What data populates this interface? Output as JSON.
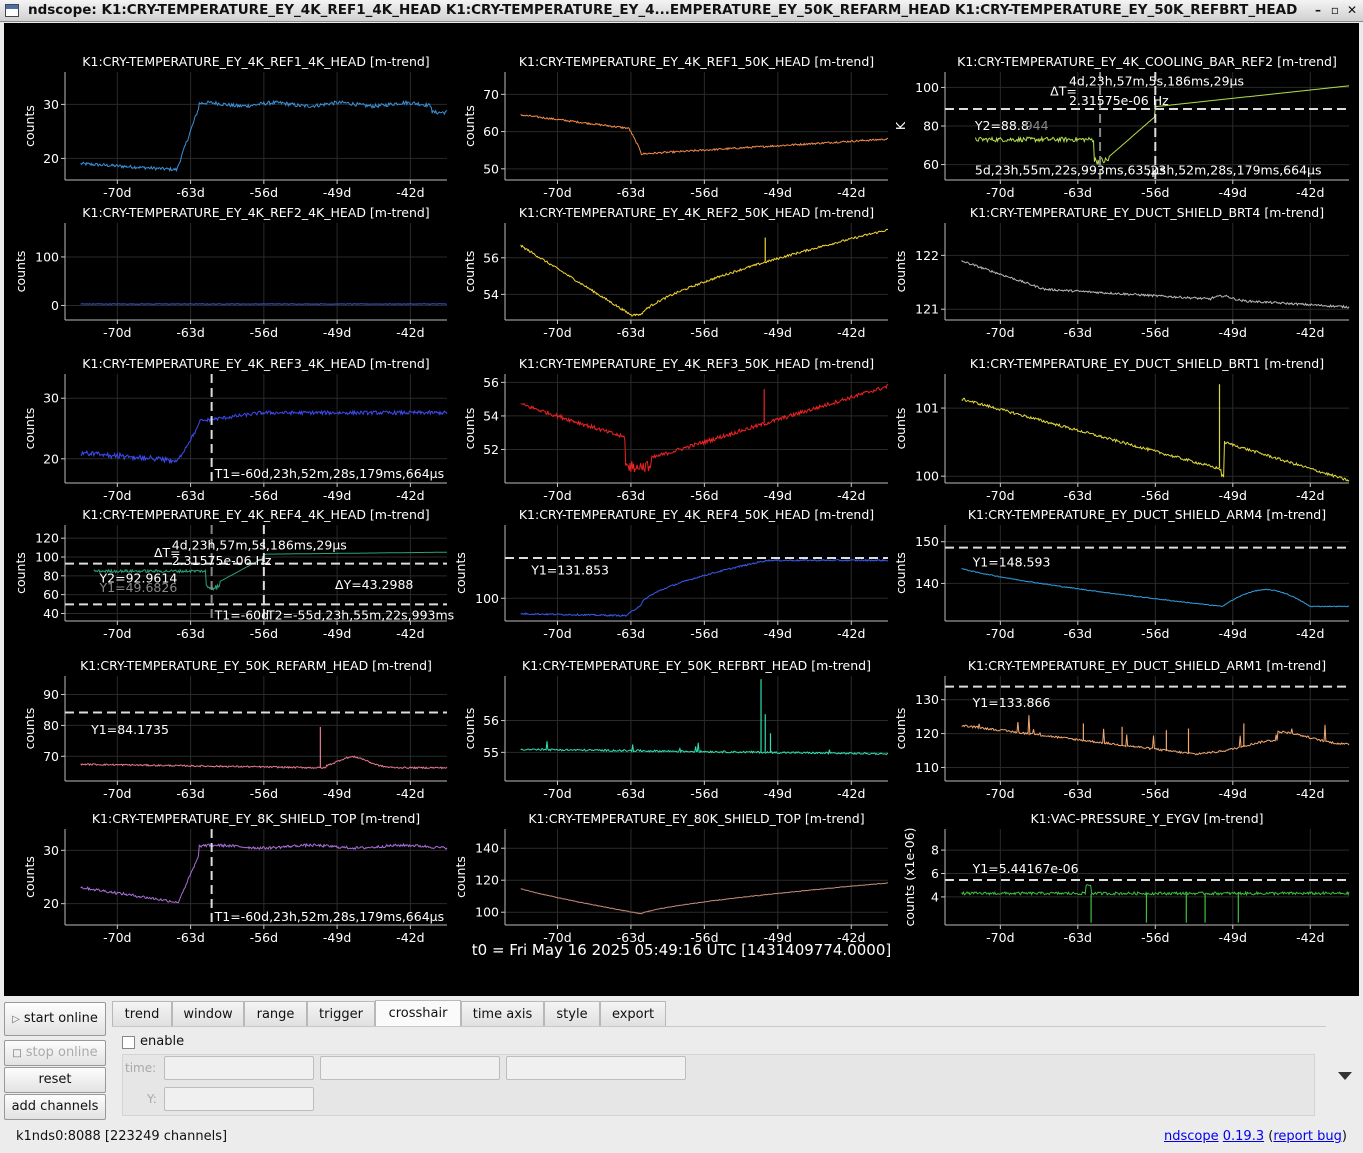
{
  "window": {
    "title": "ndscope: K1:CRY-TEMPERATURE_EY_4K_REF1_4K_HEAD K1:CRY-TEMPERATURE_EY_4...EMPERATURE_EY_50K_REFARM_HEAD K1:CRY-TEMPERATURE_EY_50K_REFBRT_HEAD",
    "minimize": "–",
    "maximize": "▫",
    "close": "✕"
  },
  "t0_label": "t0 = Fri May 16 2025 05:49:16 UTC [1431409774.0000]",
  "xticks": [
    "-70d",
    "-63d",
    "-56d",
    "-49d",
    "-42d"
  ],
  "plots": [
    {
      "title": "K1:CRY-TEMPERATURE_EY_4K_REF1_4K_HEAD [m-trend]",
      "ylabel": "counts",
      "ylim": [
        16,
        36
      ],
      "yticks": [
        20,
        30
      ],
      "color": "#3a8fd6",
      "profile": "ref1_4k",
      "annotations": []
    },
    {
      "title": "K1:CRY-TEMPERATURE_EY_4K_REF1_50K_HEAD [m-trend]",
      "ylabel": "counts",
      "ylim": [
        47,
        76
      ],
      "yticks": [
        50,
        60,
        70
      ],
      "color": "#f08a4b",
      "profile": "ref1_50k",
      "annotations": []
    },
    {
      "title": "K1:CRY-TEMPERATURE_EY_4K_COOLING_BAR_REF2 [m-trend]",
      "ylabel": "K",
      "ylim": [
        52,
        108
      ],
      "yticks": [
        60,
        80,
        100
      ],
      "color": "#b4e04a",
      "profile": "cooling",
      "annotations": [
        {
          "kind": "hline",
          "y": 88.8,
          "style": "white"
        },
        {
          "kind": "vline",
          "t": -60.99,
          "style": "grey"
        },
        {
          "kind": "vline",
          "t": -56.0,
          "style": "white"
        },
        {
          "kind": "text",
          "text": "ΔT=",
          "t": -65.5,
          "y": 98
        },
        {
          "kind": "text",
          "text": "4d,23h,57m,5s,186ms,29μs",
          "t": -63.8,
          "y": 103
        },
        {
          "kind": "text",
          "text": "2.31575e-06 Hz",
          "t": -63.8,
          "y": 93
        },
        {
          "kind": "text",
          "text": "Y2=88.8",
          "t": -72.3,
          "y": 80
        },
        {
          "kind": "text",
          "text": "944",
          "t": -67.8,
          "y": 80,
          "dim": true
        },
        {
          "kind": "text",
          "text": "5d,23h,55m,22s,993ms,635μs",
          "t": -72.3,
          "y": 57
        },
        {
          "kind": "text",
          "text": ",23h,52m,28s,179ms,664μs",
          "t": -56.8,
          "y": 57
        }
      ]
    },
    {
      "title": "K1:CRY-TEMPERATURE_EY_4K_REF2_4K_HEAD [m-trend]",
      "ylabel": "counts",
      "ylim": [
        -30,
        170
      ],
      "yticks": [
        0,
        100
      ],
      "color": "#3d55d6",
      "profile": "flat",
      "annotations": []
    },
    {
      "title": "K1:CRY-TEMPERATURE_EY_4K_REF2_50K_HEAD [m-trend]",
      "ylabel": "counts",
      "ylim": [
        52.6,
        57.9
      ],
      "yticks": [
        54,
        56
      ],
      "color": "#f2d530",
      "profile": "ref2_50k",
      "annotations": []
    },
    {
      "title": "K1:CRY-TEMPERATURE_EY_DUCT_SHIELD_BRT4 [m-trend]",
      "ylabel": "counts",
      "ylim": [
        120.8,
        122.6
      ],
      "yticks": [
        121,
        122
      ],
      "color": "#b8b8b8",
      "profile": "brt4",
      "annotations": []
    },
    {
      "title": "K1:CRY-TEMPERATURE_EY_4K_REF3_4K_HEAD [m-trend]",
      "ylabel": "counts",
      "ylim": [
        16,
        34
      ],
      "yticks": [
        20,
        30
      ],
      "color": "#3b4bf2",
      "profile": "ref3_4k",
      "annotations": [
        {
          "kind": "vline",
          "t": -60.99,
          "style": "white"
        },
        {
          "kind": "text",
          "text": "T1=-60d,23h,52m,28s,179ms,664μs",
          "t": -60.7,
          "y": 17.5
        }
      ]
    },
    {
      "title": "K1:CRY-TEMPERATURE_EY_4K_REF3_50K_HEAD [m-trend]",
      "ylabel": "counts",
      "ylim": [
        50,
        56.5
      ],
      "yticks": [
        52,
        54,
        56
      ],
      "color": "#ee2222",
      "profile": "ref3_50k",
      "annotations": []
    },
    {
      "title": "K1:CRY-TEMPERATURE_EY_DUCT_SHIELD_BRT1 [m-trend]",
      "ylabel": "counts",
      "ylim": [
        99.9,
        101.5
      ],
      "yticks": [
        100,
        101
      ],
      "color": "#e0d83a",
      "profile": "brt1",
      "annotations": []
    },
    {
      "title": "K1:CRY-TEMPERATURE_EY_4K_REF4_4K_HEAD [m-trend]",
      "ylabel": "counts",
      "ylim": [
        32,
        134
      ],
      "yticks": [
        40,
        60,
        80,
        100,
        120
      ],
      "color": "#2aa37a",
      "profile": "ref4_4k",
      "annotations": [
        {
          "kind": "hline",
          "y": 92.98,
          "style": "white"
        },
        {
          "kind": "hline",
          "y": 49.68,
          "style": "white"
        },
        {
          "kind": "vline",
          "t": -60.99,
          "style": "grey"
        },
        {
          "kind": "vline",
          "t": -56.0,
          "style": "white"
        },
        {
          "kind": "text",
          "text": "ΔT=",
          "t": -66.5,
          "y": 104
        },
        {
          "kind": "text",
          "text": "4d,23h,57m,5s,186ms,29μs",
          "t": -64.8,
          "y": 112
        },
        {
          "kind": "text",
          "text": "2.31575e-06 Hz",
          "t": -64.8,
          "y": 96
        },
        {
          "kind": "text",
          "text": "Y2=92.9614",
          "t": -71.7,
          "y": 77
        },
        {
          "kind": "text",
          "text": "Y1=49.6826",
          "t": -71.7,
          "y": 67,
          "dim": true
        },
        {
          "kind": "text",
          "text": "ΔY=43.2988",
          "t": -49.2,
          "y": 70
        },
        {
          "kind": "text",
          "text": "T1=-60d",
          "t": -60.7,
          "y": 38
        },
        {
          "kind": "text",
          "text": "T2=-55d,23h,55m,22s,993ms",
          "t": -55.7,
          "y": 38
        }
      ]
    },
    {
      "title": "K1:CRY-TEMPERATURE_EY_4K_REF4_50K_HEAD [m-trend]",
      "ylabel": "counts",
      "ylim": [
        82,
        158
      ],
      "yticks": [
        100
      ],
      "color": "#3a5aee",
      "profile": "ref4_50k",
      "annotations": [
        {
          "kind": "hline",
          "y": 131.85,
          "style": "white"
        },
        {
          "kind": "text",
          "text": "Y1=131.853",
          "t": -72.5,
          "y": 122
        }
      ]
    },
    {
      "title": "K1:CRY-TEMPERATURE_EY_DUCT_SHIELD_ARM4 [m-trend]",
      "ylabel": "counts",
      "ylim": [
        131,
        154
      ],
      "yticks": [
        140,
        150
      ],
      "color": "#2f9fe0",
      "profile": "arm4",
      "annotations": [
        {
          "kind": "hline",
          "y": 148.59,
          "style": "white"
        },
        {
          "kind": "text",
          "text": "Y1=148.593",
          "t": -72.5,
          "y": 145
        }
      ]
    },
    {
      "title": "K1:CRY-TEMPERATURE_EY_50K_REFARM_HEAD [m-trend]",
      "ylabel": "counts",
      "ylim": [
        62,
        96
      ],
      "yticks": [
        70,
        80,
        90
      ],
      "color": "#e67a92",
      "profile": "refarm",
      "annotations": [
        {
          "kind": "hline",
          "y": 84.17,
          "style": "white"
        },
        {
          "kind": "text",
          "text": "Y1=84.1735",
          "t": -72.5,
          "y": 78.5
        }
      ]
    },
    {
      "title": "K1:CRY-TEMPERATURE_EY_50K_REFBRT_HEAD [m-trend]",
      "ylabel": "counts",
      "ylim": [
        54.1,
        57.4
      ],
      "yticks": [
        55,
        56
      ],
      "color": "#2ee0b0",
      "profile": "refbrt",
      "annotations": []
    },
    {
      "title": "K1:CRY-TEMPERATURE_EY_DUCT_SHIELD_ARM1 [m-trend]",
      "ylabel": "counts",
      "ylim": [
        106,
        137
      ],
      "yticks": [
        110,
        120,
        130
      ],
      "color": "#f0a870",
      "profile": "arm1",
      "annotations": [
        {
          "kind": "hline",
          "y": 133.87,
          "style": "white"
        },
        {
          "kind": "text",
          "text": "Y1=133.866",
          "t": -72.5,
          "y": 129
        }
      ]
    },
    {
      "title": "K1:CRY-TEMPERATURE_EY_8K_SHIELD_TOP [m-trend]",
      "ylabel": "counts",
      "ylim": [
        16,
        34
      ],
      "yticks": [
        20,
        30
      ],
      "color": "#a86fd8",
      "profile": "shield8k",
      "annotations": [
        {
          "kind": "vline",
          "t": -60.99,
          "style": "white"
        },
        {
          "kind": "text",
          "text": "T1=-60d,23h,52m,28s,179ms,664μs",
          "t": -60.7,
          "y": 17.5
        }
      ]
    },
    {
      "title": "K1:CRY-TEMPERATURE_EY_80K_SHIELD_TOP [m-trend]",
      "ylabel": "counts",
      "ylim": [
        92,
        152
      ],
      "yticks": [
        100,
        120,
        140
      ],
      "color": "#c88a7a",
      "profile": "shield80k",
      "annotations": []
    },
    {
      "title": "K1:VAC-PRESSURE_Y_EYGV [m-trend]",
      "ylabel": "counts (x1e-06)",
      "ylim": [
        1.6,
        9.8
      ],
      "yticks": [
        4,
        6,
        8
      ],
      "color": "#3fbf3f",
      "profile": "vac",
      "annotations": [
        {
          "kind": "hline",
          "y": 5.44,
          "style": "white"
        },
        {
          "kind": "text",
          "text": "Y1=5.44167e-06",
          "t": -72.5,
          "y": 6.4
        }
      ]
    }
  ],
  "buttons": {
    "start_online": "start online",
    "stop_online": "stop online",
    "reset": "reset",
    "add_channels": "add channels"
  },
  "tabs": [
    "trend",
    "window",
    "range",
    "trigger",
    "crosshair",
    "time axis",
    "style",
    "export"
  ],
  "active_tab": "crosshair",
  "crosshair": {
    "enable_label": "enable",
    "time_label": "time:",
    "y_label": "Y:"
  },
  "status": {
    "server": "k1nds0:8088  [223249 channels]",
    "app_name": "ndscope",
    "version": "0.19.3",
    "report_bug": "report bug"
  }
}
